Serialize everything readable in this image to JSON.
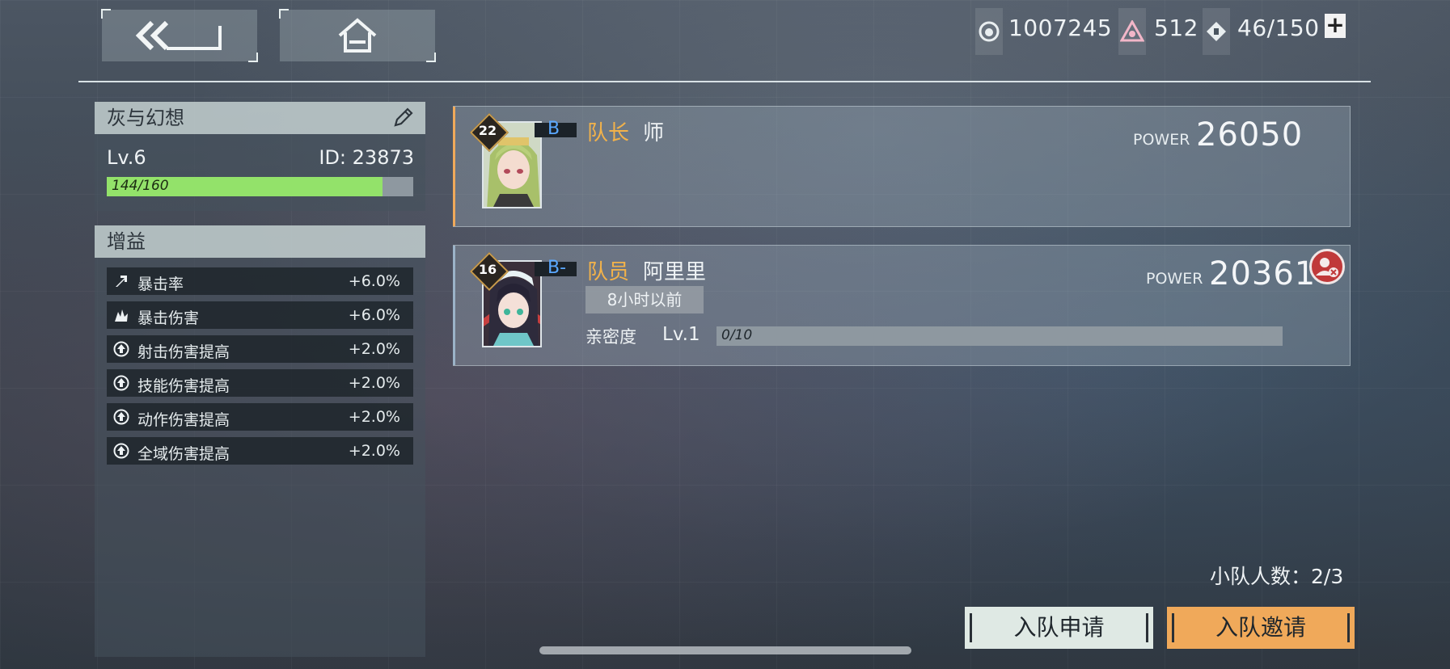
{
  "currency": {
    "coins": "1007245",
    "crystals": "512",
    "stamina": "46/150",
    "coin_icon": "coin-icon",
    "crystal_icon": "crystal-icon",
    "stamina_icon": "stamina-icon"
  },
  "profile": {
    "name": "灰与幻想",
    "level": "Lv.6",
    "id": "ID: 23873",
    "exp_text": "144/160",
    "exp_fraction": 0.9
  },
  "buffs": {
    "title": "增益",
    "items": [
      {
        "name": "暴击率",
        "value": "+6.0%"
      },
      {
        "name": "暴击伤害",
        "value": "+6.0%"
      },
      {
        "name": "射击伤害提高",
        "value": "+2.0%"
      },
      {
        "name": "技能伤害提高",
        "value": "+2.0%"
      },
      {
        "name": "动作伤害提高",
        "value": "+2.0%"
      },
      {
        "name": "全域伤害提高",
        "value": "+2.0%"
      }
    ]
  },
  "members": [
    {
      "level": "22",
      "rank": "B",
      "role": "队长",
      "name": "师",
      "power_label": "POWER",
      "power": "26050"
    },
    {
      "level": "16",
      "rank": "B-",
      "role": "队员",
      "name": "阿里里",
      "power_label": "POWER",
      "power": "20361",
      "last_online": "8小时以前",
      "affinity_label": "亲密度",
      "affinity_level": "Lv.1",
      "affinity_text": "0/10",
      "affinity_fraction": 0
    }
  ],
  "team_count": "小队人数：2/3",
  "buttons": {
    "apply": "入队申请",
    "invite": "入队邀请"
  },
  "colors": {
    "accent_orange": "#f0a95a",
    "role_gold": "#f2b24a",
    "exp_green": "#93e26a",
    "rank_blue": "#5aa8ff",
    "kick_red": "#c0393a"
  }
}
